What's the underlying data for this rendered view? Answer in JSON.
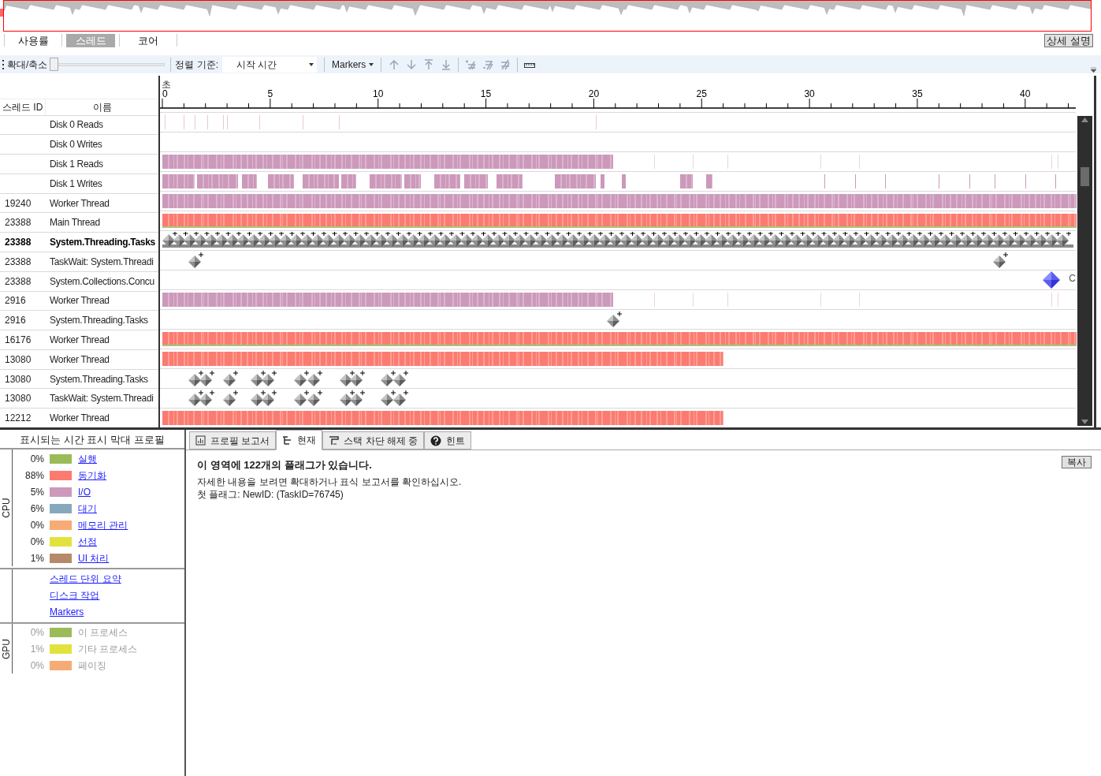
{
  "overview": {
    "tabs": [
      {
        "label": "사용률",
        "selected": false
      },
      {
        "label": "스레드",
        "selected": true
      },
      {
        "label": "코어",
        "selected": false
      }
    ],
    "detail_button": "상세 설명"
  },
  "toolbar": {
    "zoom_label": "확대/축소",
    "zoom": {
      "level": 0
    },
    "sort_label": "정렬 기준:",
    "sort_value": "시작 시간",
    "markers_menu": "Markers"
  },
  "timeline": {
    "unit": "초",
    "axis_labels": [
      "0",
      "5",
      "10",
      "15",
      "20",
      "25",
      "30",
      "35",
      "40"
    ],
    "columns": [
      "스레드 ID",
      "이름"
    ],
    "rows": [
      {
        "id": "",
        "name": "Disk 0 Reads",
        "selected": false,
        "kind": "sparse"
      },
      {
        "id": "",
        "name": "Disk 0 Writes",
        "selected": false,
        "kind": "empty"
      },
      {
        "id": "",
        "name": "Disk 1 Reads",
        "selected": false,
        "kind": "io"
      },
      {
        "id": "",
        "name": "Disk 1 Writes",
        "selected": false,
        "kind": "gapped"
      },
      {
        "id": "19240",
        "name": "Worker Thread",
        "selected": false,
        "kind": "iofull"
      },
      {
        "id": "23388",
        "name": "Main Thread",
        "selected": false,
        "kind": "sync"
      },
      {
        "id": "23388",
        "name": "System.Threading.Tasks",
        "selected": true,
        "kind": "flags"
      },
      {
        "id": "23388",
        "name": "TaskWait: System.Threadi",
        "selected": false,
        "kind": "pair"
      },
      {
        "id": "23388",
        "name": "System.Collections.Concu",
        "selected": false,
        "kind": "blue",
        "track_label": "C"
      },
      {
        "id": "2916",
        "name": "Worker Thread",
        "selected": false,
        "kind": "io"
      },
      {
        "id": "2916",
        "name": "System.Threading.Tasks",
        "selected": false,
        "kind": "single"
      },
      {
        "id": "16176",
        "name": "Worker Thread",
        "selected": false,
        "kind": "sync"
      },
      {
        "id": "13080",
        "name": "Worker Thread",
        "selected": false,
        "kind": "synclong"
      },
      {
        "id": "13080",
        "name": "System.Threading.Tasks",
        "selected": false,
        "kind": "cluster"
      },
      {
        "id": "13080",
        "name": "TaskWait: System.Threadi",
        "selected": false,
        "kind": "cluster"
      },
      {
        "id": "12212",
        "name": "Worker Thread",
        "selected": false,
        "kind": "synclong"
      }
    ]
  },
  "legend": {
    "title": "표시되는 시간 표시 막대 프로필",
    "cpu": {
      "label": "CPU",
      "items": [
        {
          "percent": "0%",
          "color": "#9bbb59",
          "label": "실행",
          "disabled": false
        },
        {
          "percent": "88%",
          "color": "#fb7b70",
          "label": "동기화",
          "disabled": false
        },
        {
          "percent": "5%",
          "color": "#cc99bb",
          "label": "I/O",
          "disabled": false
        },
        {
          "percent": "6%",
          "color": "#86a8bc",
          "label": "대기",
          "disabled": false
        },
        {
          "percent": "0%",
          "color": "#f7ab74",
          "label": "메모리 관리",
          "disabled": false
        },
        {
          "percent": "0%",
          "color": "#e2e23f",
          "label": "선점",
          "disabled": false
        },
        {
          "percent": "1%",
          "color": "#b5896a",
          "label": "UI 처리",
          "disabled": false
        }
      ]
    },
    "links": [
      "스레드 단위 요약",
      "디스크 작업",
      "Markers"
    ],
    "gpu": {
      "label": "GPU",
      "items": [
        {
          "percent": "0%",
          "color": "#9bbb59",
          "label": "이 프로세스",
          "disabled": true
        },
        {
          "percent": "1%",
          "color": "#e2e23f",
          "label": "기타 프로세스",
          "disabled": true
        },
        {
          "percent": "0%",
          "color": "#f7ab74",
          "label": "페이징",
          "disabled": true
        }
      ]
    }
  },
  "details": {
    "tabs": [
      {
        "label": "프로필 보고서",
        "selected": false
      },
      {
        "label": "현재",
        "selected": true
      },
      {
        "label": "스택 차단 해제 중",
        "selected": false
      },
      {
        "label": "힌트",
        "selected": false
      }
    ],
    "copy_button": "복사",
    "heading": "이 영역에 122개의 플래그가 있습니다.",
    "lines": [
      "자세한 내용을 보려면 확대하거나 표식 보고서를 확인하십시오.",
      "첫 플래그: NewID: (TaskID=76745)"
    ]
  }
}
